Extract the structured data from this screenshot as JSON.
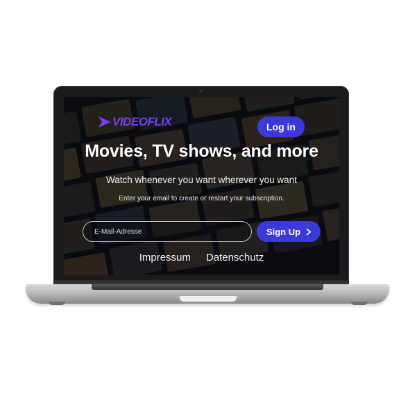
{
  "header": {
    "brand": "VIDEOFLIX",
    "login_label": "Log in"
  },
  "hero": {
    "title": "Movies, TV shows, and more",
    "subtitle": "Watch whenever you want wherever you want",
    "hint": "Enter your email to create or restart your subscription."
  },
  "signup_form": {
    "email_placeholder": "E-Mail-Adresse",
    "button_label": "Sign Up"
  },
  "footer": {
    "links": [
      "Impressum",
      "Datenschutz"
    ]
  },
  "colors": {
    "accent": "#3b3ad8",
    "brand": "#7b3df0"
  },
  "icons": {
    "brand_mark": "play-chevron-icon",
    "signup_arrow": "chevron-right-icon"
  }
}
